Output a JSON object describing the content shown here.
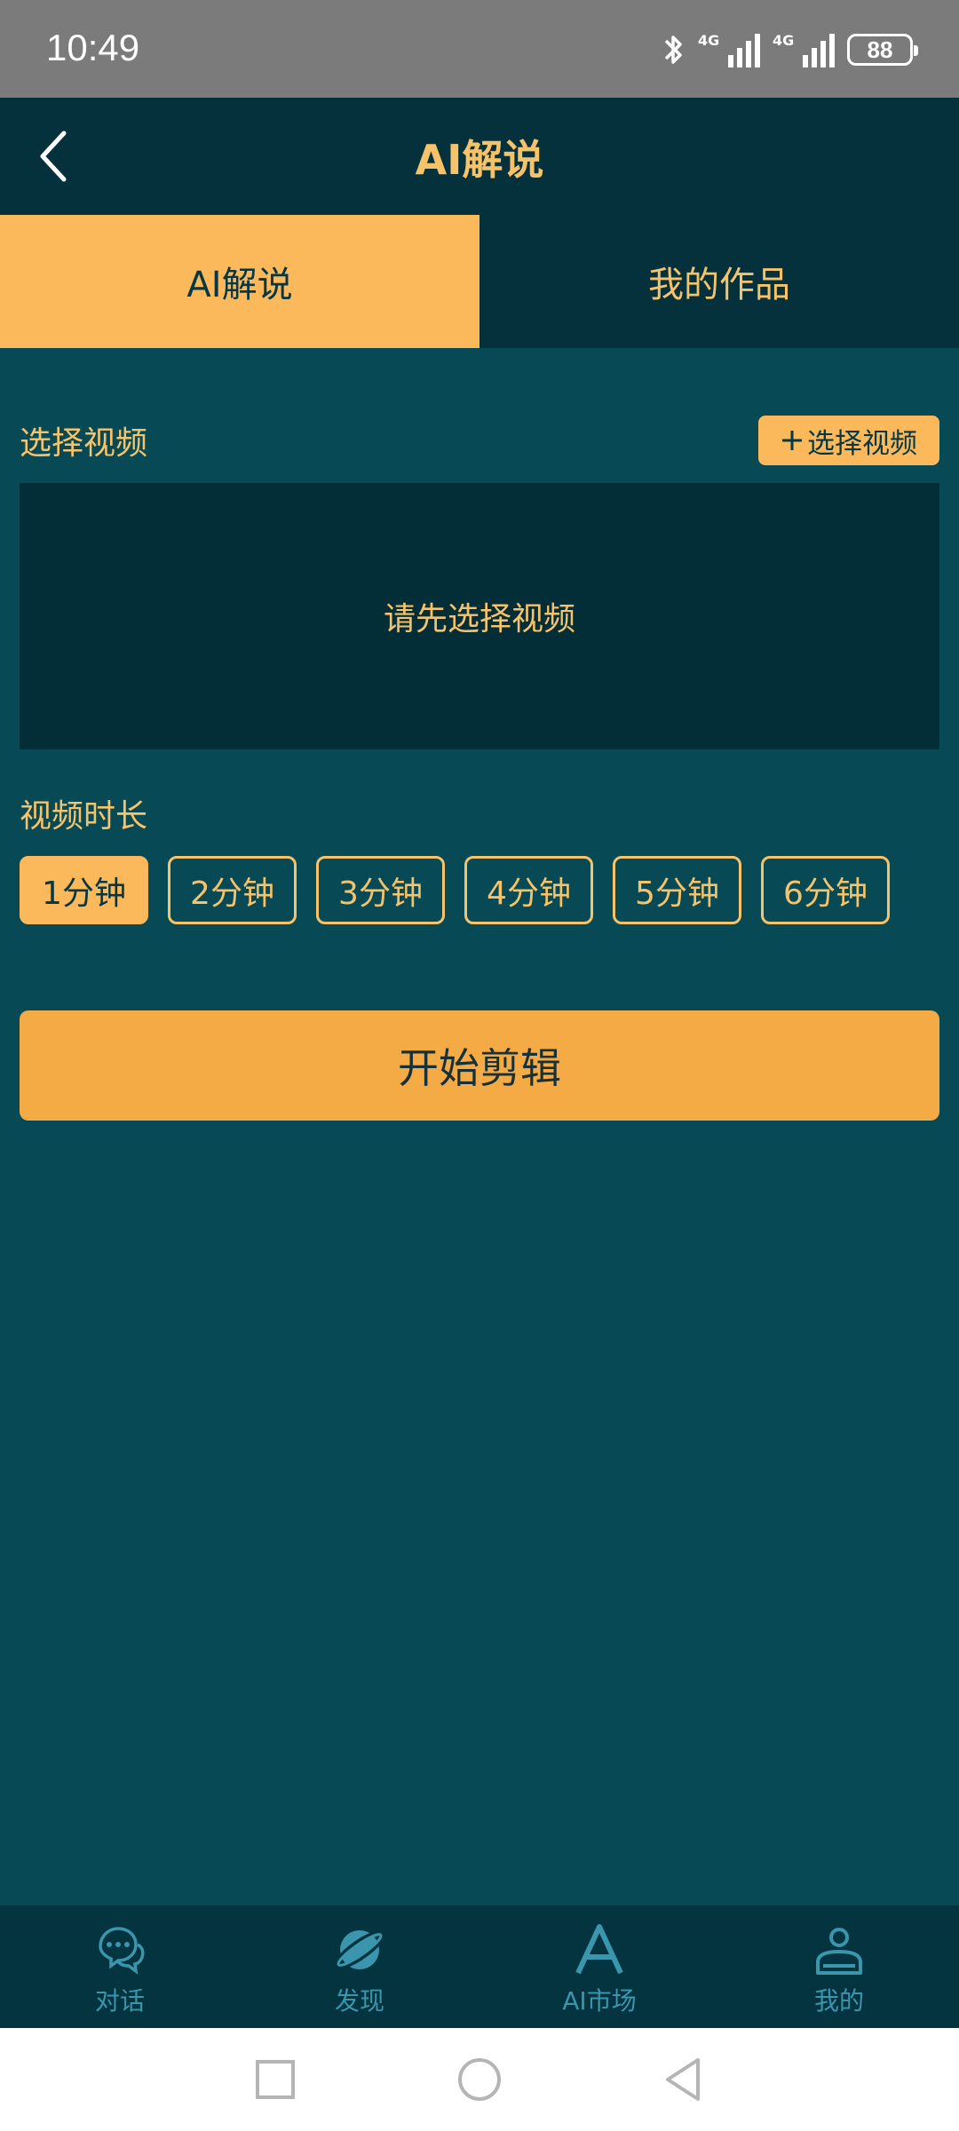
{
  "status_bar": {
    "time": "10:49",
    "signal1_label": "4G",
    "signal2_label": "4G",
    "battery": "88",
    "icons": [
      "bluetooth-icon",
      "signal-icon",
      "signal-icon",
      "battery-icon"
    ]
  },
  "header": {
    "title": "AI解说",
    "back_icon": "chevron-left-icon"
  },
  "tabs": [
    {
      "label": "AI解说",
      "active": true
    },
    {
      "label": "我的作品",
      "active": false
    }
  ],
  "video_section": {
    "label": "选择视频",
    "select_button_label": "选择视频",
    "select_button_icon": "plus-icon",
    "placeholder": "请先选择视频"
  },
  "duration_section": {
    "label": "视频时长",
    "options": [
      "1分钟",
      "2分钟",
      "3分钟",
      "4分钟",
      "5分钟",
      "6分钟"
    ],
    "selected": "1分钟"
  },
  "start_button_label": "开始剪辑",
  "bottom_nav": [
    {
      "label": "对话",
      "icon": "chat-bubbles-icon"
    },
    {
      "label": "发现",
      "icon": "planet-icon"
    },
    {
      "label": "AI市场",
      "icon": "letter-a-icon"
    },
    {
      "label": "我的",
      "icon": "person-icon"
    }
  ],
  "colors": {
    "background": "#074a55",
    "header": "#04313b",
    "accent": "#fbb95c",
    "button": "#f4ab45",
    "text_accent": "#f7c36a",
    "nav_icon": "#3a95ad"
  }
}
